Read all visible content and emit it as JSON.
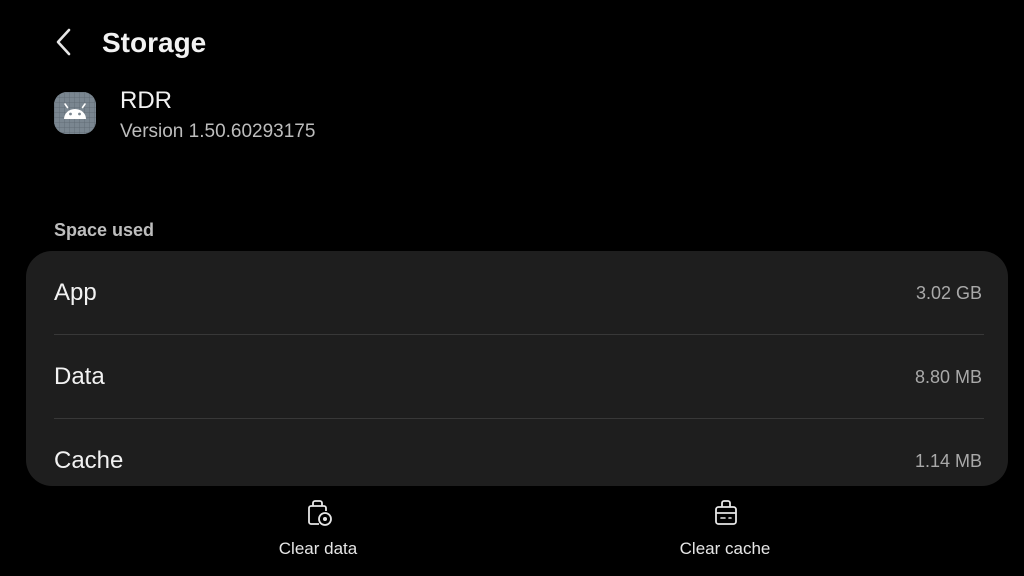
{
  "header": {
    "back_icon": "chevron-left-icon",
    "title": "Storage"
  },
  "app": {
    "icon": "android-icon",
    "name": "RDR",
    "version": "Version 1.50.60293175"
  },
  "space_used": {
    "section_label": "Space used",
    "rows": [
      {
        "label": "App",
        "value": "3.02 GB"
      },
      {
        "label": "Data",
        "value": "8.80 MB"
      },
      {
        "label": "Cache",
        "value": "1.14 MB"
      }
    ]
  },
  "actions": [
    {
      "label": "Clear data",
      "icon": "clear-data-icon"
    },
    {
      "label": "Clear cache",
      "icon": "clear-cache-icon"
    }
  ],
  "colors": {
    "background": "#000000",
    "card": "#1e1e1e",
    "text_primary": "#f2f2f2",
    "text_secondary": "#a9a9a9",
    "app_icon_bg": "#7a8690"
  }
}
